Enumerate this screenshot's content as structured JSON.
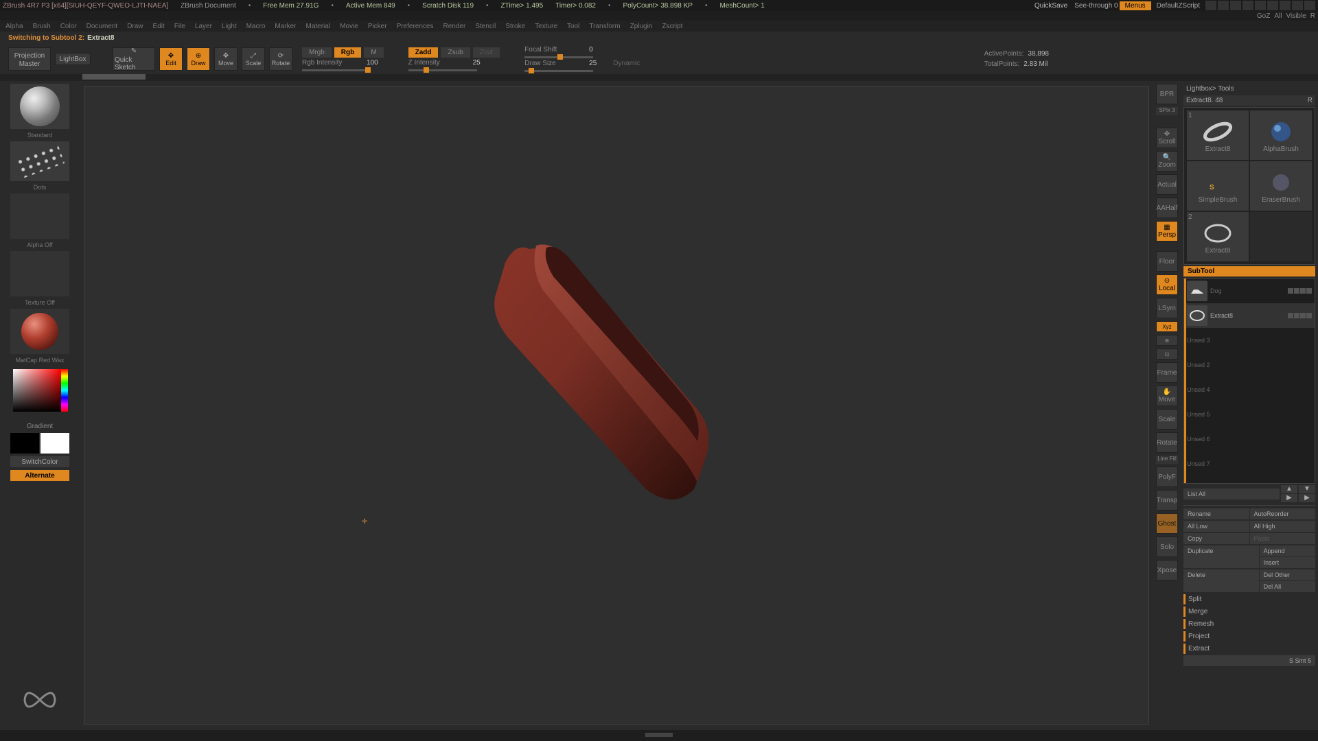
{
  "titlebar": {
    "app": "ZBrush 4R7 P3 [x64][SIUH-QEYF-QWEO-LJTI-NAEA]",
    "doc": "ZBrush Document",
    "stats": {
      "freemem": "Free Mem 27.91G",
      "activemem": "Active Mem 849",
      "scratch": "Scratch Disk 119",
      "ztime": "ZTime> 1.495",
      "timer": "Timer> 0.082",
      "polycount": "PolyCount> 38.898 KP",
      "meshcount": "MeshCount> 1"
    },
    "quicksave": "QuickSave",
    "seethrough": "See-through   0",
    "menus": "Menus",
    "defaultscript": "DefaultZScript"
  },
  "row2": {
    "goz": "GoZ",
    "all": "All",
    "visible": "Visible",
    "r": "R"
  },
  "menubar": [
    "Alpha",
    "Brush",
    "Color",
    "Document",
    "Draw",
    "Edit",
    "File",
    "Layer",
    "Light",
    "Macro",
    "Marker",
    "Material",
    "Movie",
    "Picker",
    "Preferences",
    "Render",
    "Stencil",
    "Stroke",
    "Texture",
    "Tool",
    "Transform",
    "Zplugin",
    "Zscript"
  ],
  "status": {
    "label": "Switching to Subtool 2:",
    "value": "Extract8"
  },
  "toolbar": {
    "proj_master": "Projection Master",
    "lightbox": "LightBox",
    "quicksketch": "Quick Sketch",
    "edit": "Edit",
    "draw": "Draw",
    "move": "Move",
    "scale": "Scale",
    "rotate": "Rotate",
    "mrgb": "Mrgb",
    "rgb": "Rgb",
    "m": "M",
    "rgb_intensity_label": "Rgb Intensity",
    "rgb_intensity_val": "100",
    "zadd": "Zadd",
    "zsub": "Zsub",
    "zcut": "Zcut",
    "z_intensity_label": "Z Intensity",
    "z_intensity_val": "25",
    "focal_label": "Focal Shift",
    "focal_val": "0",
    "drawsize_label": "Draw Size",
    "drawsize_val": "25",
    "dynamic": "Dynamic",
    "activepoints_label": "ActivePoints:",
    "activepoints_val": "38,898",
    "totalpoints_label": "TotalPoints:",
    "totalpoints_val": "2.83 Mil"
  },
  "left": {
    "brush": "Standard",
    "stroke": "Dots",
    "alpha": "Alpha Off",
    "texture": "Texture Off",
    "material": "MatCap Red Wax",
    "gradient": "Gradient",
    "switchcolor": "SwitchColor",
    "alternate": "Alternate"
  },
  "shelf": {
    "bpr": "BPR",
    "spix": "SPix 3",
    "scroll": "Scroll",
    "zoom": "Zoom",
    "actual": "Actual",
    "aahalf": "AAHalf",
    "persp": "Persp",
    "floor": "Floor",
    "local": "Local",
    "lsym": "LSym",
    "xyz": "Xyz",
    "frame": "Frame",
    "move": "Move",
    "scale": "Scale",
    "rotate": "Rotate",
    "linefill": "Line Fill",
    "polyf": "PolyF",
    "transp": "Transp",
    "ghost": "Ghost",
    "solo": "Solo",
    "xpose": "Xpose"
  },
  "right": {
    "lightbox_tools": "Lightbox> Tools",
    "active_tool": "Extract8. 48",
    "r": "R",
    "tools": [
      {
        "num": "1",
        "name": "Extract8"
      },
      {
        "num": "",
        "name": "AlphaBrush"
      },
      {
        "num": "",
        "name": "SimpleBrush"
      },
      {
        "num": "",
        "name": "EraserBrush"
      },
      {
        "num": "2",
        "name": "Extract8"
      }
    ],
    "subtool_header": "SubTool",
    "subtools": [
      {
        "name": "Dog",
        "sel": false
      },
      {
        "name": "Extract8",
        "sel": true
      },
      {
        "name": "Unsed 3",
        "sel": false
      },
      {
        "name": "Unsed 2",
        "sel": false
      },
      {
        "name": "Unsed 4",
        "sel": false
      },
      {
        "name": "Unsed 5",
        "sel": false
      },
      {
        "name": "Unsed 6",
        "sel": false
      },
      {
        "name": "Unsed 7",
        "sel": false
      }
    ],
    "listall": "List All",
    "rename": "Rename",
    "autoreorder": "AutoReorder",
    "alllow": "All Low",
    "allhigh": "All High",
    "copy": "Copy",
    "paste": "Paste",
    "duplicate": "Duplicate",
    "append": "Append",
    "insert": "Insert",
    "delete": "Delete",
    "delother": "Del Other",
    "delall": "Del All",
    "split": "Split",
    "merge": "Merge",
    "remesh": "Remesh",
    "project": "Project",
    "extract": "Extract",
    "footer": "S Smt 5"
  }
}
